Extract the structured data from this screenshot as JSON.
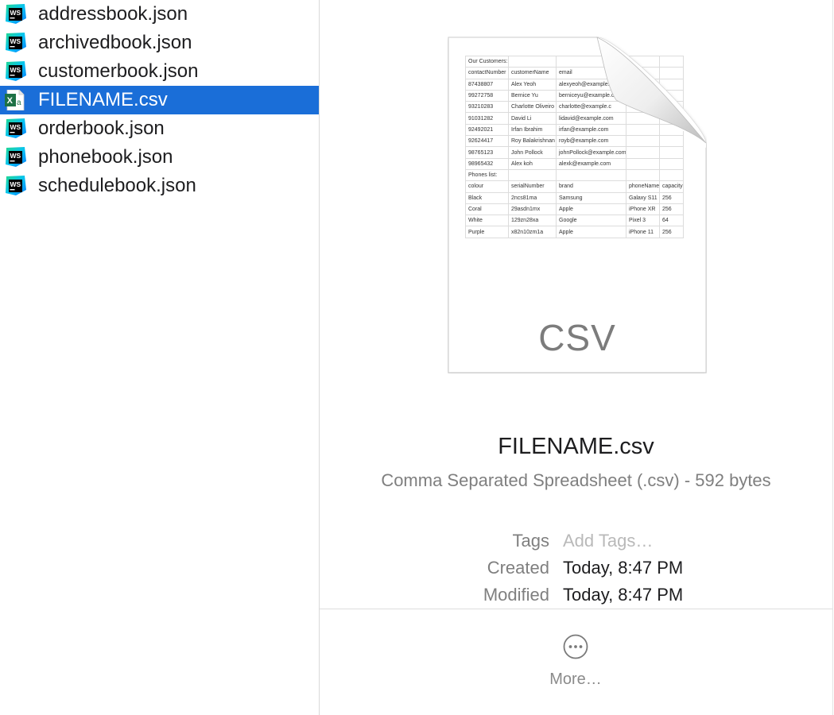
{
  "file_list": {
    "items": [
      {
        "name": "addressbook.json",
        "icon": "webstorm-icon",
        "selected": false
      },
      {
        "name": "archivedbook.json",
        "icon": "webstorm-icon",
        "selected": false
      },
      {
        "name": "customerbook.json",
        "icon": "webstorm-icon",
        "selected": false
      },
      {
        "name": "FILENAME.csv",
        "icon": "excel-csv-icon",
        "selected": true
      },
      {
        "name": "orderbook.json",
        "icon": "webstorm-icon",
        "selected": false
      },
      {
        "name": "phonebook.json",
        "icon": "webstorm-icon",
        "selected": false
      },
      {
        "name": "schedulebook.json",
        "icon": "webstorm-icon",
        "selected": false
      }
    ],
    "selection_color": "#1a6ed8"
  },
  "preview": {
    "thumbnail": {
      "type_label": "CSV",
      "rows": [
        [
          "Our Customers:",
          "",
          "",
          "",
          ""
        ],
        [
          "contactNumber",
          "customerName",
          "email",
          "",
          ""
        ],
        [
          "87438807",
          "Alex Yeoh",
          "alexyeoh@example.c",
          "",
          ""
        ],
        [
          "99272758",
          "Bernice Yu",
          "berniceyu@example.c",
          "",
          ""
        ],
        [
          "93210283",
          "Charlotte Oliveiro",
          "charlotte@example.c",
          "",
          ""
        ],
        [
          "91031282",
          "David Li",
          "lidavid@example.com",
          "",
          ""
        ],
        [
          "92492021",
          "Irfan Ibrahim",
          "irfan@example.com",
          "",
          ""
        ],
        [
          "92624417",
          "Roy Balakrishnan",
          "royb@example.com",
          "",
          ""
        ],
        [
          "98765123",
          "John Pollock",
          "johnPollock@example.com",
          "",
          ""
        ],
        [
          "98965432",
          "Alex koh",
          "alexk@example.com",
          "",
          ""
        ],
        [
          "Phones list:",
          "",
          "",
          "",
          ""
        ],
        [
          "colour",
          "serialNumber",
          "brand",
          "phoneName",
          "capacity"
        ],
        [
          "Black",
          "2ncs81ma",
          "Samsung",
          "Galaxy S11",
          "256"
        ],
        [
          "Coral",
          "29asdn1mx",
          "Apple",
          "iPhone XR",
          "256"
        ],
        [
          "White",
          "129zn28xa",
          "Google",
          "Pixel 3",
          "64"
        ],
        [
          "Purple",
          "x82n10zm1a",
          "Apple",
          "iPhone 11",
          "256"
        ]
      ]
    },
    "file_name": "FILENAME.csv",
    "kind_and_size": "Comma Separated Spreadsheet (.csv) - 592 bytes",
    "metadata": {
      "tags_label": "Tags",
      "tags_placeholder": "Add Tags…",
      "created_label": "Created",
      "created_value": "Today, 8:47 PM",
      "modified_label": "Modified",
      "modified_value": "Today, 8:47 PM"
    },
    "more_label": "More…",
    "more_icon": "ellipsis-circle-icon"
  }
}
